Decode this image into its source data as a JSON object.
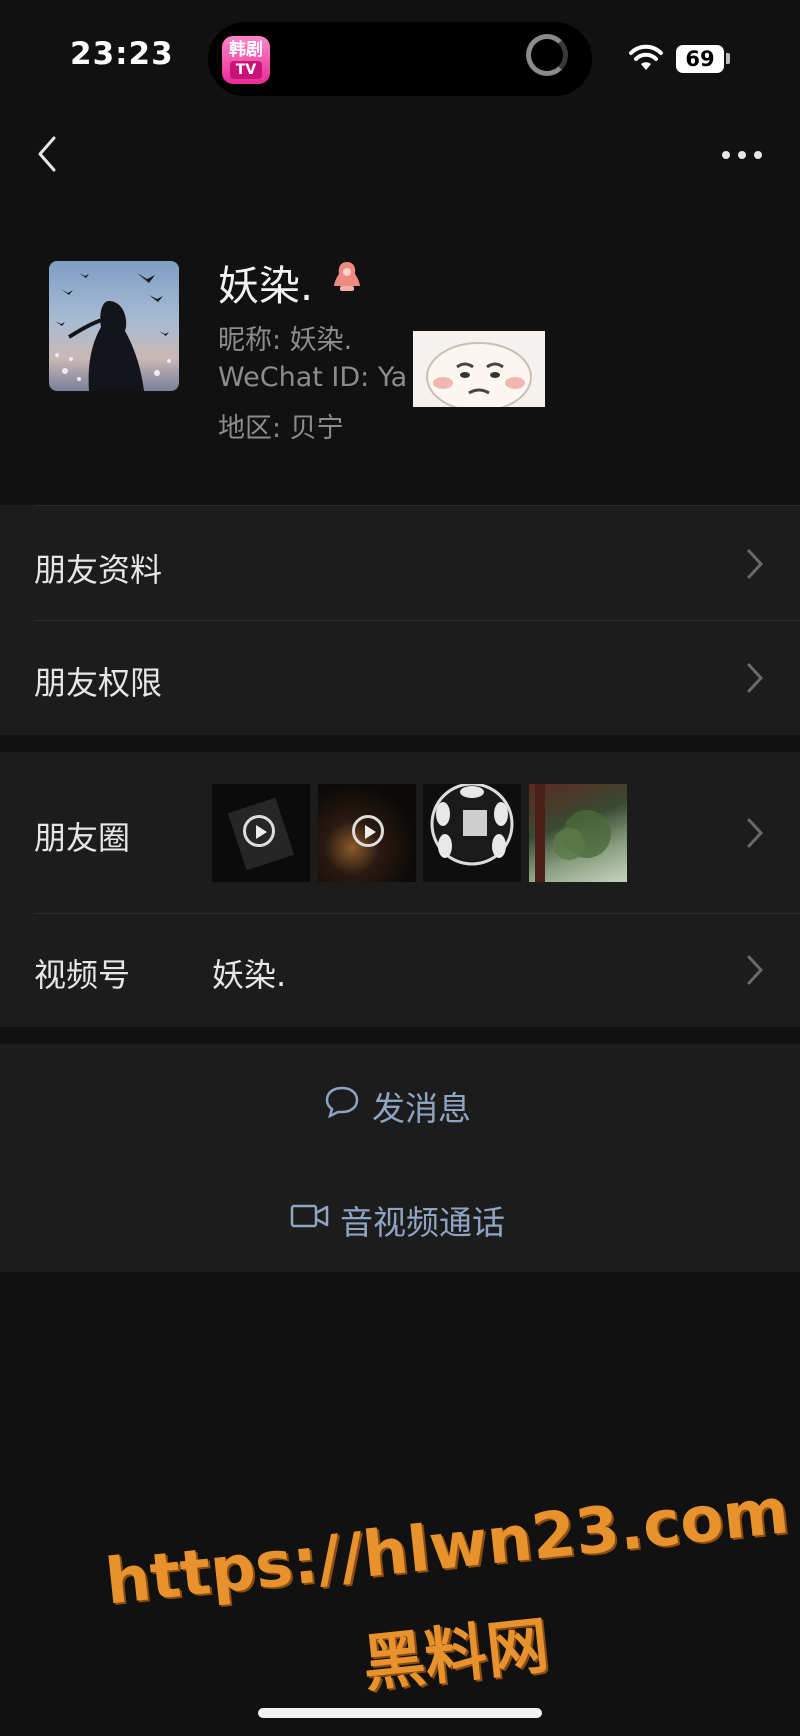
{
  "status_bar": {
    "time": "23:23",
    "battery": "69",
    "app_icon_line1": "韩剧",
    "app_icon_line2": "TV"
  },
  "profile": {
    "name": "妖染.",
    "nickname": "昵称: 妖染.",
    "wechat_id": "WeChat ID: Ya",
    "region": "地区: 贝宁",
    "gender_icon": "female-icon"
  },
  "menu": {
    "friend_profile": "朋友资料",
    "friend_permissions": "朋友权限"
  },
  "moments": {
    "label": "朋友圈"
  },
  "channels": {
    "label": "视频号",
    "value": "妖染."
  },
  "actions": {
    "message": "发消息",
    "call": "音视频通话"
  },
  "watermark": {
    "url": "https://hlwn23.com",
    "site": "黑料网"
  },
  "colors": {
    "action_blue": "#8fa3c3",
    "watermark_orange": "#e8922e"
  }
}
